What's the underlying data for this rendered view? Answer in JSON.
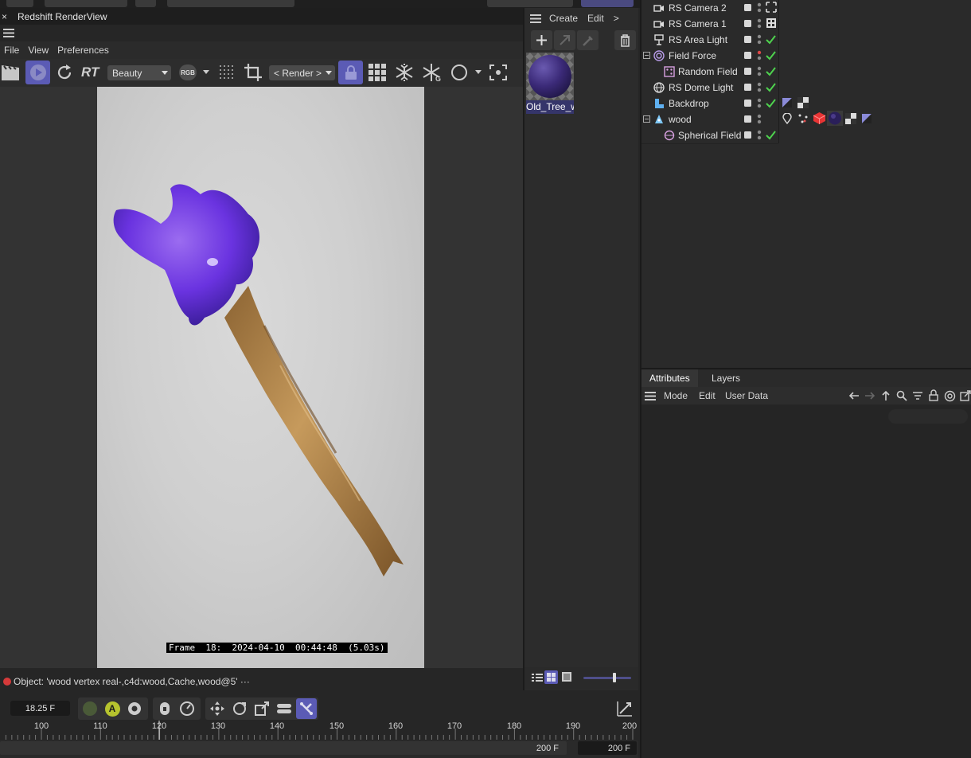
{
  "render_view": {
    "title": "Redshift RenderView",
    "close_glyph": "×",
    "menu": [
      "File",
      "View",
      "Preferences"
    ],
    "rt_label": "RT",
    "aov_select": "Beauty",
    "rgb_label": "RGB",
    "render_select": "< Render >",
    "frame_info": "Frame  18:  2024-04-10  00:44:48  (5.03s)",
    "status_text": "Object: 'wood vertex real-,c4d:wood,Cache,wood@5'  ···",
    "status_color": "#d53a3a",
    "accent": "#5b5bb5"
  },
  "material_manager": {
    "menu": [
      "Create",
      "Edit",
      ">"
    ],
    "material_name": "Old_Tree_w"
  },
  "object_manager": {
    "objects": [
      {
        "name": "RS Camera 2",
        "icon": "camera-icon"
      },
      {
        "name": "RS Camera 1",
        "icon": "camera-icon"
      },
      {
        "name": "RS Area Light",
        "icon": "area-light-icon"
      },
      {
        "name": "Field Force",
        "icon": "field-force-icon"
      },
      {
        "name": "Random Field",
        "icon": "random-field-icon"
      },
      {
        "name": "RS Dome Light",
        "icon": "dome-light-icon"
      },
      {
        "name": "Backdrop",
        "icon": "backdrop-icon"
      },
      {
        "name": "wood",
        "icon": "wood-object-icon"
      },
      {
        "name": "Spherical Field",
        "icon": "spherical-field-icon"
      }
    ]
  },
  "attributes": {
    "tabs": [
      "Attributes",
      "Layers"
    ],
    "active_tab": "Attributes",
    "menu": [
      "Mode",
      "Edit",
      "User Data"
    ]
  },
  "timeline": {
    "current_frame": "18.25 F",
    "auto_key_label": "A",
    "ruler": [
      "100",
      "110",
      "120",
      "130",
      "140",
      "150",
      "160",
      "170",
      "180",
      "190",
      "200"
    ],
    "end_frame_a": "200 F",
    "end_frame_b": "200 F"
  }
}
